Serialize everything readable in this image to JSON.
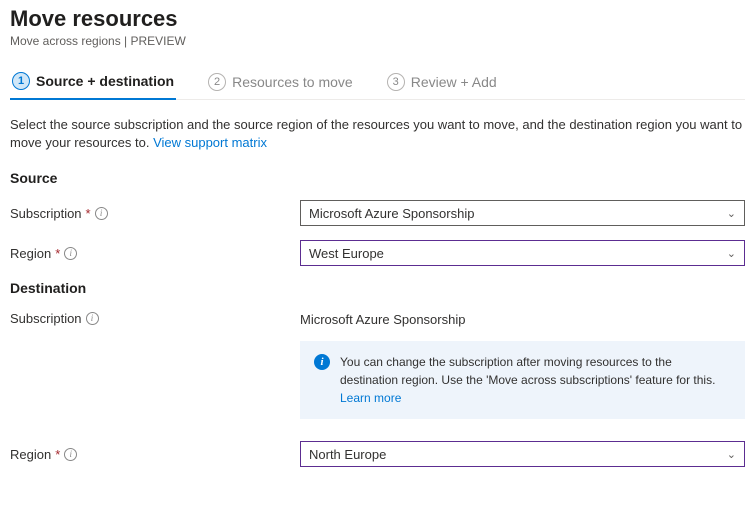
{
  "header": {
    "title": "Move resources",
    "subtitle": "Move across regions | PREVIEW"
  },
  "tabs": [
    {
      "num": "1",
      "label": "Source + destination"
    },
    {
      "num": "2",
      "label": "Resources to move"
    },
    {
      "num": "3",
      "label": "Review + Add"
    }
  ],
  "intro": {
    "text": "Select the source subscription and the source region of the resources you want to move, and the destination region you want to move your resources to. ",
    "link": "View support matrix"
  },
  "source": {
    "heading": "Source",
    "subscription_label": "Subscription",
    "subscription_value": "Microsoft Azure Sponsorship",
    "region_label": "Region",
    "region_value": "West Europe"
  },
  "destination": {
    "heading": "Destination",
    "subscription_label": "Subscription",
    "subscription_value": "Microsoft Azure Sponsorship",
    "info_text": "You can change the subscription after moving resources to the destination region. Use the 'Move across subscriptions' feature for this. ",
    "info_link": "Learn more",
    "region_label": "Region",
    "region_value": "North Europe"
  },
  "glyph": {
    "asterisk": "*"
  }
}
